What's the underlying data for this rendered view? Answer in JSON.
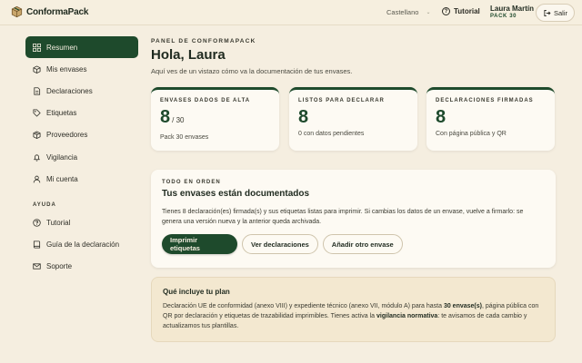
{
  "brand": {
    "name": "ConformaPack"
  },
  "header": {
    "language": "Castellano",
    "tutorial_label": "Tutorial",
    "user_name": "Laura Martín",
    "user_pack": "PACK 30",
    "logout_label": "Salir"
  },
  "sidebar": {
    "items": [
      {
        "label": "Resumen",
        "icon": "grid-icon",
        "active": true
      },
      {
        "label": "Mis envases",
        "icon": "box-icon"
      },
      {
        "label": "Declaraciones",
        "icon": "document-icon"
      },
      {
        "label": "Etiquetas",
        "icon": "tag-icon"
      },
      {
        "label": "Proveedores",
        "icon": "package-icon"
      },
      {
        "label": "Vigilancia",
        "icon": "bell-icon"
      },
      {
        "label": "Mi cuenta",
        "icon": "user-icon"
      }
    ],
    "help_section_label": "AYUDA",
    "help_items": [
      {
        "label": "Tutorial",
        "icon": "question-icon"
      },
      {
        "label": "Guía de la declaración",
        "icon": "book-icon"
      },
      {
        "label": "Soporte",
        "icon": "mail-icon"
      }
    ]
  },
  "main": {
    "panel_label": "PANEL DE CONFORMAPACK",
    "greeting": "Hola, Laura",
    "subtitle": "Aquí ves de un vistazo cómo va la documentación de tus envases.",
    "stats": [
      {
        "label": "ENVASES DADOS DE ALTA",
        "value": "8",
        "suffix": "/ 30",
        "note": "Pack 30 envases"
      },
      {
        "label": "LISTOS PARA DECLARAR",
        "value": "8",
        "suffix": "",
        "note": "0 con datos pendientes"
      },
      {
        "label": "DECLARACIONES FIRMADAS",
        "value": "8",
        "suffix": "",
        "note": "Con página pública y QR"
      }
    ],
    "status_card": {
      "kicker": "TODO EN ORDEN",
      "title": "Tus envases están documentados",
      "body": "Tienes 8 declaración(es) firmada(s) y sus etiquetas listas para imprimir. Si cambias los datos de un envase, vuelve a firmarlo: se genera una versión nueva y la anterior queda archivada.",
      "buttons": {
        "print": "Imprimir etiquetas",
        "view": "Ver declaraciones",
        "add": "Añadir otro envase"
      }
    },
    "plan": {
      "title": "Qué incluye tu plan",
      "body_1": "Declaración UE de conformidad (anexo VIII) y expediente técnico (anexo VII, módulo A) para hasta ",
      "body_bold_1": "30 envase(s)",
      "body_2": ", página pública con QR por declaración y etiquetas de trazabilidad imprimibles. Tienes activa la ",
      "body_bold_2": "vigilancia normativa",
      "body_3": ": te avisamos de cada cambio y actualizamos tus plantillas."
    }
  },
  "colors": {
    "accent": "#1e4a2c",
    "background": "#f5eee0",
    "card": "#fdfaf3"
  }
}
